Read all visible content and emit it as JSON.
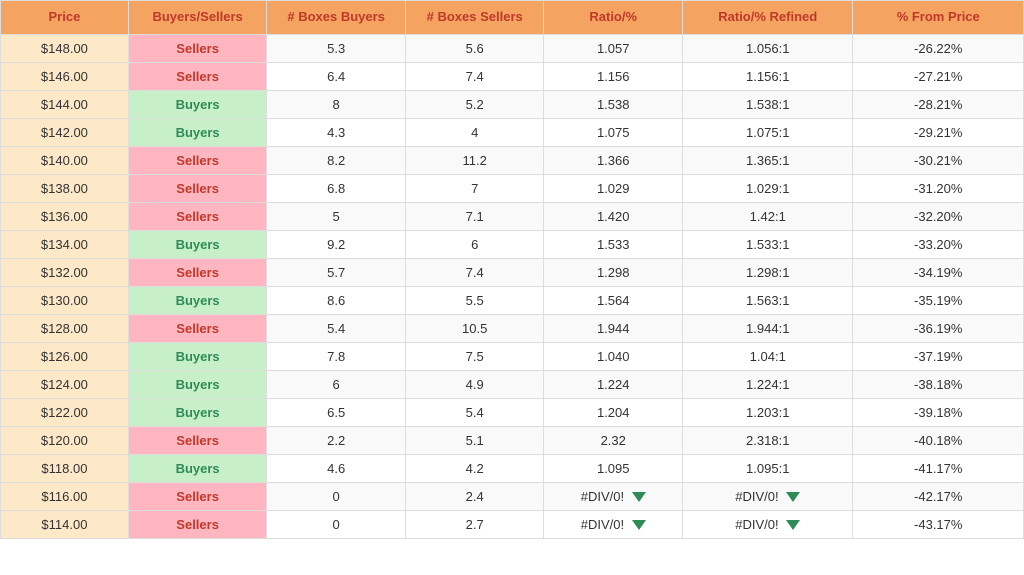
{
  "headers": {
    "price": "Price",
    "buyers_sellers": "Buyers/Sellers",
    "boxes_buyers": "# Boxes Buyers",
    "boxes_sellers": "# Boxes Sellers",
    "ratio": "Ratio/%",
    "ratio_refined": "Ratio/% Refined",
    "from_price": "% From Price"
  },
  "rows": [
    {
      "price": "$148.00",
      "type": "Sellers",
      "boxes_buyers": "5.3",
      "boxes_sellers": "5.6",
      "ratio": "1.057",
      "ratio_refined": "1.056:1",
      "from_price": "-26.22%",
      "div_error_ratio": false,
      "div_error_refined": false
    },
    {
      "price": "$146.00",
      "type": "Sellers",
      "boxes_buyers": "6.4",
      "boxes_sellers": "7.4",
      "ratio": "1.156",
      "ratio_refined": "1.156:1",
      "from_price": "-27.21%",
      "div_error_ratio": false,
      "div_error_refined": false
    },
    {
      "price": "$144.00",
      "type": "Buyers",
      "boxes_buyers": "8",
      "boxes_sellers": "5.2",
      "ratio": "1.538",
      "ratio_refined": "1.538:1",
      "from_price": "-28.21%",
      "div_error_ratio": false,
      "div_error_refined": false
    },
    {
      "price": "$142.00",
      "type": "Buyers",
      "boxes_buyers": "4.3",
      "boxes_sellers": "4",
      "ratio": "1.075",
      "ratio_refined": "1.075:1",
      "from_price": "-29.21%",
      "div_error_ratio": false,
      "div_error_refined": false
    },
    {
      "price": "$140.00",
      "type": "Sellers",
      "boxes_buyers": "8.2",
      "boxes_sellers": "11.2",
      "ratio": "1.366",
      "ratio_refined": "1.365:1",
      "from_price": "-30.21%",
      "div_error_ratio": false,
      "div_error_refined": false
    },
    {
      "price": "$138.00",
      "type": "Sellers",
      "boxes_buyers": "6.8",
      "boxes_sellers": "7",
      "ratio": "1.029",
      "ratio_refined": "1.029:1",
      "from_price": "-31.20%",
      "div_error_ratio": false,
      "div_error_refined": false
    },
    {
      "price": "$136.00",
      "type": "Sellers",
      "boxes_buyers": "5",
      "boxes_sellers": "7.1",
      "ratio": "1.420",
      "ratio_refined": "1.42:1",
      "from_price": "-32.20%",
      "div_error_ratio": false,
      "div_error_refined": false
    },
    {
      "price": "$134.00",
      "type": "Buyers",
      "boxes_buyers": "9.2",
      "boxes_sellers": "6",
      "ratio": "1.533",
      "ratio_refined": "1.533:1",
      "from_price": "-33.20%",
      "div_error_ratio": false,
      "div_error_refined": false
    },
    {
      "price": "$132.00",
      "type": "Sellers",
      "boxes_buyers": "5.7",
      "boxes_sellers": "7.4",
      "ratio": "1.298",
      "ratio_refined": "1.298:1",
      "from_price": "-34.19%",
      "div_error_ratio": false,
      "div_error_refined": false
    },
    {
      "price": "$130.00",
      "type": "Buyers",
      "boxes_buyers": "8.6",
      "boxes_sellers": "5.5",
      "ratio": "1.564",
      "ratio_refined": "1.563:1",
      "from_price": "-35.19%",
      "div_error_ratio": false,
      "div_error_refined": false
    },
    {
      "price": "$128.00",
      "type": "Sellers",
      "boxes_buyers": "5.4",
      "boxes_sellers": "10.5",
      "ratio": "1.944",
      "ratio_refined": "1.944:1",
      "from_price": "-36.19%",
      "div_error_ratio": false,
      "div_error_refined": false
    },
    {
      "price": "$126.00",
      "type": "Buyers",
      "boxes_buyers": "7.8",
      "boxes_sellers": "7.5",
      "ratio": "1.040",
      "ratio_refined": "1.04:1",
      "from_price": "-37.19%",
      "div_error_ratio": false,
      "div_error_refined": false
    },
    {
      "price": "$124.00",
      "type": "Buyers",
      "boxes_buyers": "6",
      "boxes_sellers": "4.9",
      "ratio": "1.224",
      "ratio_refined": "1.224:1",
      "from_price": "-38.18%",
      "div_error_ratio": false,
      "div_error_refined": false
    },
    {
      "price": "$122.00",
      "type": "Buyers",
      "boxes_buyers": "6.5",
      "boxes_sellers": "5.4",
      "ratio": "1.204",
      "ratio_refined": "1.203:1",
      "from_price": "-39.18%",
      "div_error_ratio": false,
      "div_error_refined": false
    },
    {
      "price": "$120.00",
      "type": "Sellers",
      "boxes_buyers": "2.2",
      "boxes_sellers": "5.1",
      "ratio": "2.32",
      "ratio_refined": "2.318:1",
      "from_price": "-40.18%",
      "div_error_ratio": false,
      "div_error_refined": false
    },
    {
      "price": "$118.00",
      "type": "Buyers",
      "boxes_buyers": "4.6",
      "boxes_sellers": "4.2",
      "ratio": "1.095",
      "ratio_refined": "1.095:1",
      "from_price": "-41.17%",
      "div_error_ratio": false,
      "div_error_refined": false
    },
    {
      "price": "$116.00",
      "type": "Sellers",
      "boxes_buyers": "0",
      "boxes_sellers": "2.4",
      "ratio": "#DIV/0!",
      "ratio_refined": "#DIV/0!",
      "from_price": "-42.17%",
      "div_error_ratio": true,
      "div_error_refined": true
    },
    {
      "price": "$114.00",
      "type": "Sellers",
      "boxes_buyers": "0",
      "boxes_sellers": "2.7",
      "ratio": "#DIV/0!",
      "ratio_refined": "#DIV/0!",
      "from_price": "-43.17%",
      "div_error_ratio": true,
      "div_error_refined": true
    }
  ]
}
